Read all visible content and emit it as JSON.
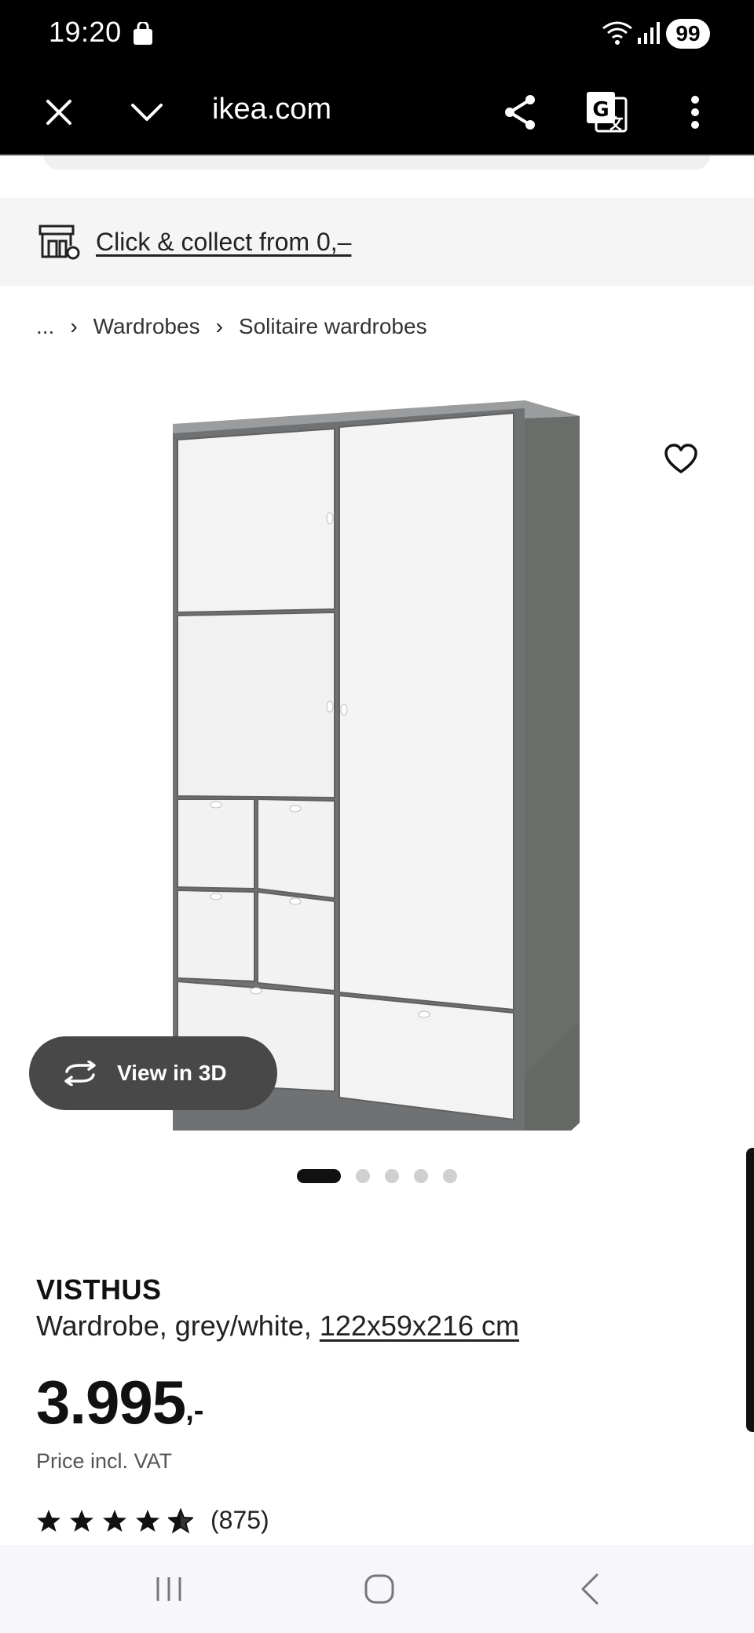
{
  "status_bar": {
    "time": "19:20",
    "battery": "99"
  },
  "browser": {
    "url": "ikea.com"
  },
  "collect": {
    "label": "Click & collect from 0,–"
  },
  "breadcrumb": {
    "ellipsis": "...",
    "items": [
      "Wardrobes",
      "Solitaire wardrobes"
    ]
  },
  "gallery": {
    "view_3d_label": "View in 3D",
    "active_index": 0,
    "total": 5
  },
  "product": {
    "name": "VISTHUS",
    "description": "Wardrobe, grey/white, ",
    "dimensions": "122x59x216 cm",
    "price_integer": "3.995",
    "price_decimal": ",-",
    "price_note": "Price incl. VAT",
    "rating_stars": 4.5,
    "review_count": "(875)"
  },
  "colors": {
    "status_bg": "#000000",
    "collect_bg": "#f5f5f5",
    "view3d_bg": "#484848",
    "nav_bg": "#f6f6fb"
  }
}
